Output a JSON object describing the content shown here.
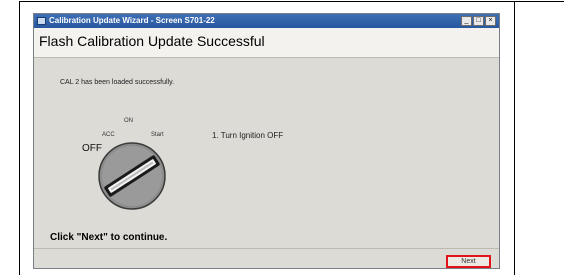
{
  "window": {
    "title": "Calibration Update Wizard - Screen S701-22",
    "controls": [
      "_",
      "□",
      "×"
    ]
  },
  "page": {
    "title": "Flash Calibration Update Successful",
    "message": "CAL 2 has been loaded successfully.",
    "instruction": "1. Turn Ignition OFF",
    "continue_prompt": "Click \"Next\" to continue."
  },
  "ignition": {
    "labels": {
      "acc": "ACC",
      "on": "ON",
      "start": "Start",
      "off": "OFF"
    },
    "position": "OFF"
  },
  "buttons": {
    "next": "Next"
  },
  "colors": {
    "title_bar": "#2f62aa",
    "highlight": "#e2141a",
    "window_bg": "#dddbd6"
  }
}
